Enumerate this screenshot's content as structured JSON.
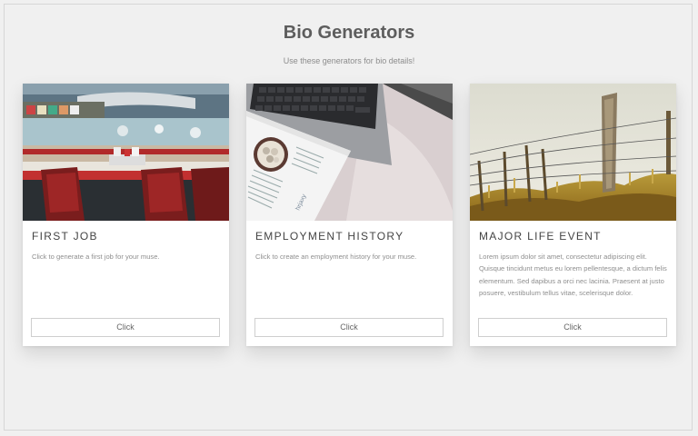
{
  "header": {
    "title": "Bio Generators",
    "subtitle": "Use these generators for bio details!"
  },
  "cards": [
    {
      "title": "FIRST JOB",
      "text": "Click to generate a first job for your muse.",
      "button": "Click",
      "image": "diner-photo"
    },
    {
      "title": "EMPLOYMENT HISTORY",
      "text": "Click to create an employment history for your muse.",
      "button": "Click",
      "image": "laptop-desk-photo"
    },
    {
      "title": "MAJOR LIFE EVENT",
      "text": "Lorem ipsum dolor sit amet, consectetur adipiscing elit. Quisque tincidunt metus eu lorem pellentesque, a dictum felis elementum. Sed dapibus a orci nec lacinia. Praesent at justo posuere, vestibulum tellus vitae, scelerisque dolor.",
      "button": "Click",
      "image": "fence-field-photo"
    }
  ]
}
